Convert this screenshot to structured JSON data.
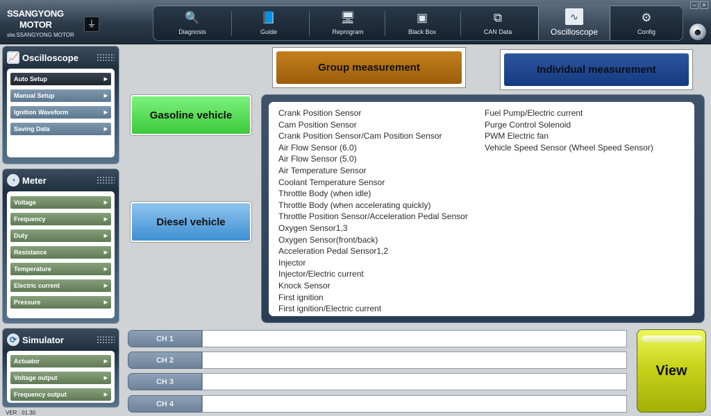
{
  "brand": {
    "line1": "SSANGYONG",
    "line2": "MOTOR",
    "sub": "siw.SSANGYONG MOTOR"
  },
  "nav": {
    "items": [
      {
        "label": "Diagnosis",
        "icon": "magnifier-icon"
      },
      {
        "label": "Guide",
        "icon": "book-icon"
      },
      {
        "label": "Reprogram",
        "icon": "monitor-icon"
      },
      {
        "label": "Black Box",
        "icon": "box-icon"
      },
      {
        "label": "CAN Data",
        "icon": "network-icon"
      },
      {
        "label": "Oscilloscope",
        "icon": "oscilloscope-icon",
        "active": true
      },
      {
        "label": "Config",
        "icon": "config-icon"
      }
    ]
  },
  "panels": {
    "oscilloscope": {
      "title": "Oscilloscope",
      "items": [
        "Auto Setup",
        "Manual Setup",
        "Ignition Waveform",
        "Saving Data"
      ]
    },
    "meter": {
      "title": "Meter",
      "items": [
        "Voltage",
        "Frequency",
        "Duty",
        "Resistance",
        "Temperature",
        "Electric current",
        "Pressure"
      ]
    },
    "simulator": {
      "title": "Simulator",
      "items": [
        "Actuator",
        "Voltage output",
        "Frequency output"
      ]
    }
  },
  "buttons": {
    "group": "Group measurement",
    "individual": "Individual measurement",
    "gasoline": "Gasoline vehicle",
    "diesel": "Diesel vehicle",
    "view": "View"
  },
  "sensors": {
    "column1": [
      "Crank Position Sensor",
      "Cam Position Sensor",
      "Crank Position Sensor/Cam Position Sensor",
      "Air Flow Sensor (6.0)",
      "Air Flow Sensor (5.0)",
      "Air Temperature Sensor",
      "Coolant Temperature Sensor",
      "Throttle Body (when idle)",
      "Throttle Body (when accelerating quickly)",
      "Throttle Position Sensor/Acceleration Pedal Sensor",
      "Oxygen Sensor1,3",
      "Oxygen Sensor(front/back)",
      "Acceleration Pedal Sensor1,2",
      "Injector",
      "Injector/Electric current",
      "Knock Sensor",
      "First ignition",
      "First ignition/Electric current"
    ],
    "column2": [
      "Fuel Pump/Electric current",
      "Purge Control Solenoid",
      "PWM Electric fan",
      "Vehicle Speed Sensor (Wheel Speed Sensor)"
    ]
  },
  "channels": [
    {
      "label": "CH 1",
      "value": ""
    },
    {
      "label": "CH 2",
      "value": ""
    },
    {
      "label": "CH 3",
      "value": ""
    },
    {
      "label": "CH 4",
      "value": ""
    }
  ],
  "version": "VER : 01.30"
}
